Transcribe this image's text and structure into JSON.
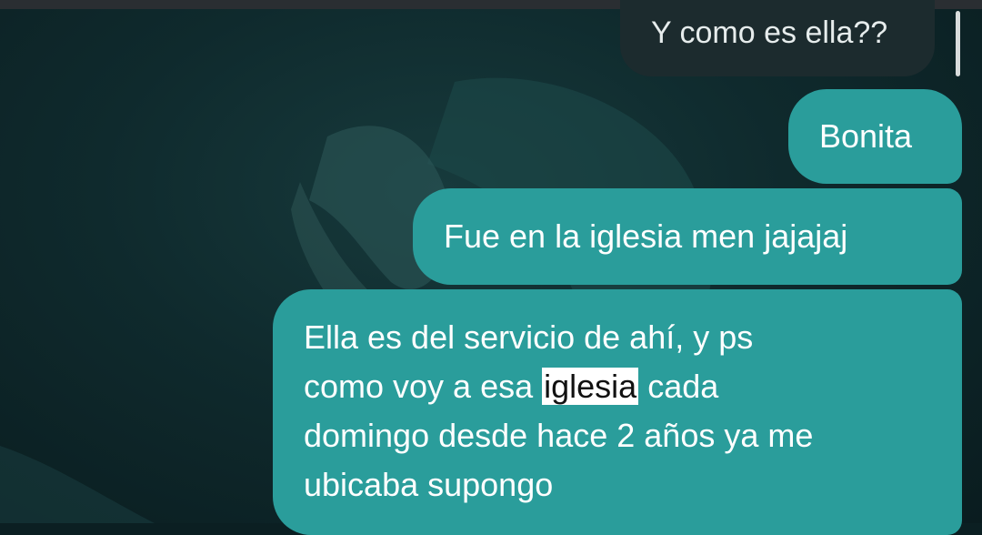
{
  "chat": {
    "messages": [
      {
        "direction": "received",
        "text": "Y como es ella??"
      },
      {
        "direction": "sent",
        "text": "Bonita"
      },
      {
        "direction": "sent",
        "text": "Fue en la iglesia men jajajaj"
      },
      {
        "direction": "sent",
        "line1": "Ella es del servicio de ahí, y ps",
        "line2_before": "como voy a esa ",
        "line2_highlight": "iglesia",
        "line2_after": " cada",
        "line3": "domingo desde hace 2 años ya me",
        "line4": "ubicaba supongo"
      }
    ]
  },
  "colors": {
    "sent_bubble": "#2a9d9b",
    "received_bubble": "#1c2b2e",
    "wallpaper": "#0f2a2d",
    "highlight": "#ffffff"
  }
}
